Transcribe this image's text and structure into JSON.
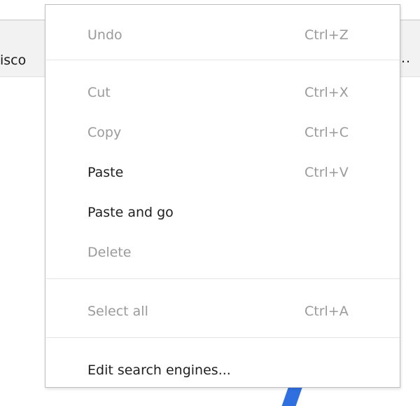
{
  "background": {
    "bookmark_left_text": "isco",
    "bookmark_right_text": ".."
  },
  "colors": {
    "enabled_text": "#1f1f1f",
    "disabled_text": "#9a9a9a",
    "menu_border": "#bfbfbf",
    "separator": "#e4e4e4",
    "accent_blue": "#2f6fe0"
  },
  "menu": {
    "undo": {
      "label": "Undo",
      "shortcut": "Ctrl+Z",
      "enabled": false
    },
    "cut": {
      "label": "Cut",
      "shortcut": "Ctrl+X",
      "enabled": false
    },
    "copy": {
      "label": "Copy",
      "shortcut": "Ctrl+C",
      "enabled": false
    },
    "paste": {
      "label": "Paste",
      "shortcut": "Ctrl+V",
      "enabled": true
    },
    "paste_and_go": {
      "label": "Paste and go",
      "enabled": true
    },
    "delete": {
      "label": "Delete",
      "enabled": false
    },
    "select_all": {
      "label": "Select all",
      "shortcut": "Ctrl+A",
      "enabled": false
    },
    "edit_search_engines": {
      "label": "Edit search engines...",
      "enabled": true
    }
  }
}
